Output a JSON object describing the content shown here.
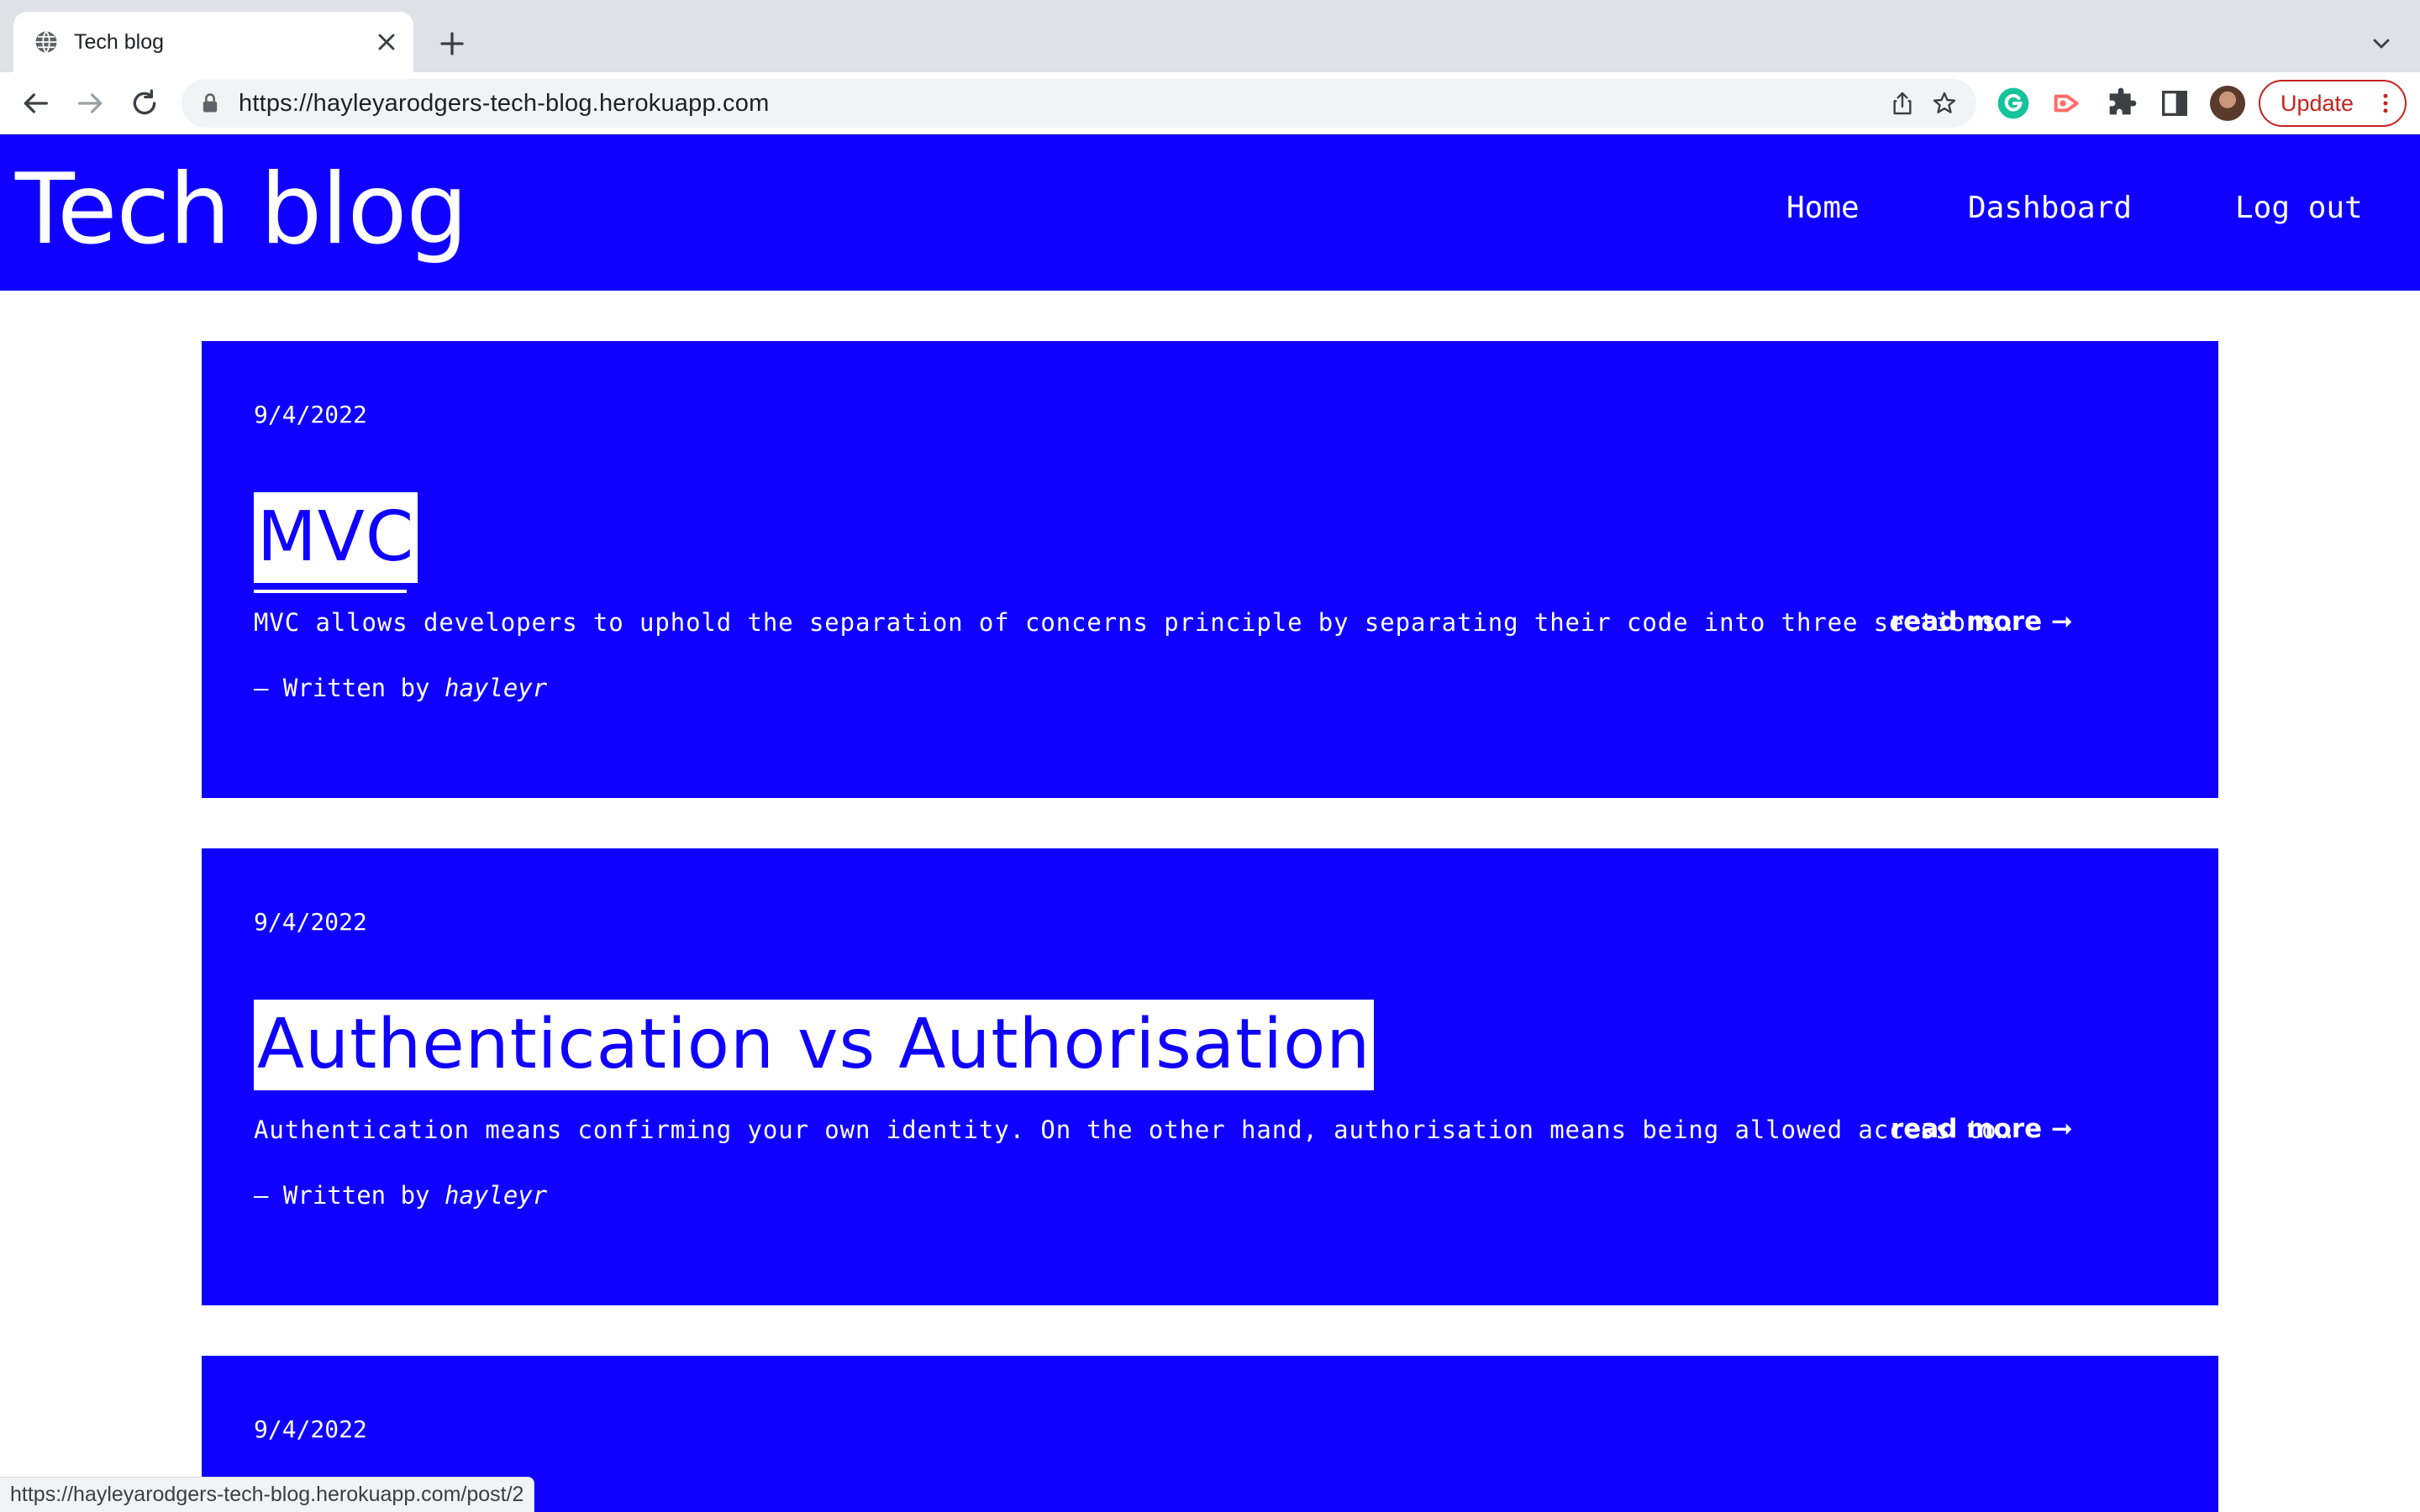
{
  "browser": {
    "tab": {
      "title": "Tech blog",
      "favicon": "globe-icon"
    },
    "address_bar": {
      "url": "https://hayleyarodgers-tech-blog.herokuapp.com"
    },
    "update_label": "Update",
    "status_url": "https://hayleyarodgers-tech-blog.herokuapp.com/post/2",
    "extension_icons": [
      "grammarly-icon",
      "screen-recorder-icon",
      "puzzle-extensions-icon",
      "side-panel-icon"
    ]
  },
  "site": {
    "title": "Tech blog",
    "nav": {
      "home": "Home",
      "dashboard": "Dashboard",
      "logout": "Log out"
    },
    "colors": {
      "brand_blue": "#0f00ff",
      "text": "#ffffff"
    }
  },
  "posts": [
    {
      "date": "9/4/2022",
      "title": "MVC",
      "excerpt": "MVC allows developers to uphold the separation of concerns principle by separating their code into three sections…",
      "read_more": "read more ➞",
      "author_prefix": "— Written by",
      "author": "hayleyr"
    },
    {
      "date": "9/4/2022",
      "title": "Authentication vs Authorisation",
      "excerpt": "Authentication means confirming your own identity. On the other hand, authorisation means being allowed access to…",
      "read_more": "read more ➞",
      "author_prefix": "— Written by",
      "author": "hayleyr"
    },
    {
      "date": "9/4/2022"
    }
  ]
}
